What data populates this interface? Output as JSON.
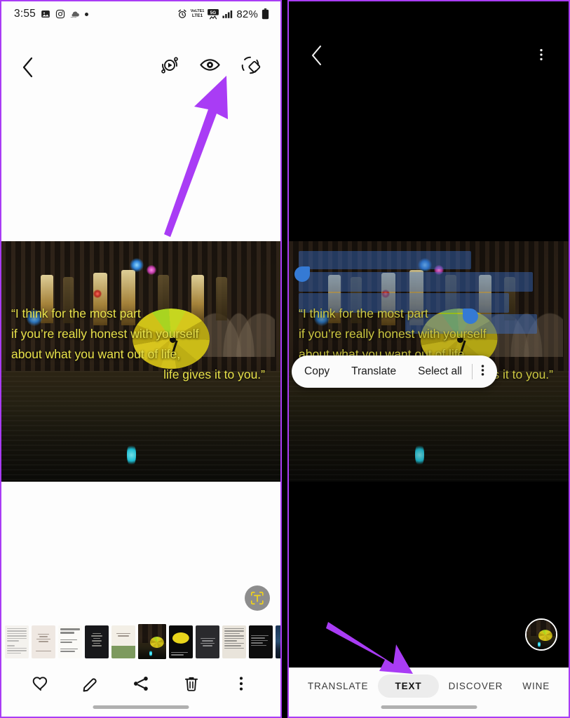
{
  "meta": {
    "accent_purple": "#a93cf5",
    "quote_color": "#e8e24a",
    "selection_blue": "#3d8bf2"
  },
  "left_panel": {
    "statusbar": {
      "time": "3:55",
      "battery_percent": "82%",
      "network_voice": "VoLTE1",
      "network_speed": "5G",
      "icons": [
        "gallery-icon",
        "instagram-icon",
        "weather-icon",
        "dot-icon",
        "alarm-icon",
        "volte-icon",
        "5g-icon",
        "signal-icon",
        "battery-icon"
      ]
    },
    "toolbar": {
      "back_label": "‹",
      "icons": [
        {
          "name": "motion-photo-icon",
          "label": "Motion photo"
        },
        {
          "name": "bixby-vision-eye-icon",
          "label": "Bixby Vision"
        },
        {
          "name": "rotate-ar-icon",
          "label": "AR Doodle"
        }
      ]
    },
    "photo": {
      "alt": "Yellow umbrella on a rainy night street",
      "quote_lines": [
        "“I think for the most part",
        "if you’re really honest with yourself",
        "about what you want out of life,",
        "life gives it to you.”"
      ]
    },
    "scan_button": {
      "label": "T",
      "name": "text-scan-button"
    },
    "filmstrip": {
      "count": 11,
      "selected_index": 5,
      "items": [
        {
          "name": "thumb-document-1",
          "kind": "text-light"
        },
        {
          "name": "thumb-quote-2",
          "kind": "text-light"
        },
        {
          "name": "thumb-arabic-3",
          "kind": "text-light"
        },
        {
          "name": "thumb-dark-quote-4",
          "kind": "text-dark"
        },
        {
          "name": "thumb-flowers-5",
          "kind": "photo-light"
        },
        {
          "name": "thumb-umbrella-night-6",
          "kind": "photo-night"
        },
        {
          "name": "thumb-yellow-umbrella-7",
          "kind": "photo-dark"
        },
        {
          "name": "thumb-dark-text-8",
          "kind": "text-dark"
        },
        {
          "name": "thumb-article-9",
          "kind": "text-light"
        },
        {
          "name": "thumb-cancer-10",
          "kind": "text-dark"
        },
        {
          "name": "thumb-night-sky-11",
          "kind": "photo-blue"
        }
      ]
    },
    "actions": [
      {
        "name": "favorite-button",
        "icon": "heart-icon"
      },
      {
        "name": "edit-button",
        "icon": "pencil-icon"
      },
      {
        "name": "share-button",
        "icon": "share-icon"
      },
      {
        "name": "delete-button",
        "icon": "trash-icon"
      },
      {
        "name": "more-options-button",
        "icon": "more-vertical-icon"
      }
    ]
  },
  "right_panel": {
    "toolbar": {
      "back_label": "‹",
      "more_label": "⋮"
    },
    "context_menu": {
      "items": [
        "Copy",
        "Translate",
        "Select all"
      ],
      "overflow_label": "⋮"
    },
    "selected_text_lines": [
      "“I think for the most part",
      "if you’re really honest with yourself",
      "about what you want out of life,",
      "life gives it to you.”"
    ],
    "tabs": [
      {
        "label": "TRANSLATE",
        "active": false
      },
      {
        "label": "TEXT",
        "active": true
      },
      {
        "label": "DISCOVER",
        "active": false
      },
      {
        "label": "WINE",
        "active": false
      }
    ],
    "thumbnail": {
      "name": "source-image-thumbnail"
    }
  },
  "annotations": [
    {
      "name": "arrow-to-eye-icon",
      "color": "#a93cf5",
      "points_at": "bixby-vision-eye-icon"
    },
    {
      "name": "arrow-to-text-tab",
      "color": "#a93cf5",
      "points_at": "tab-text"
    }
  ]
}
